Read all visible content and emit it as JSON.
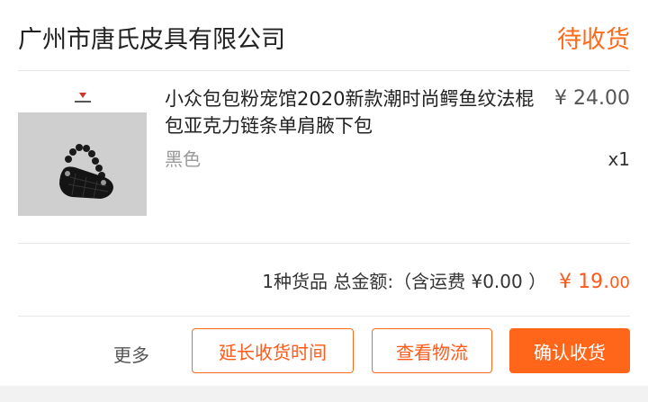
{
  "header": {
    "shop_name": "广州市唐氏皮具有限公司",
    "status": "待收货"
  },
  "item": {
    "title": "小众包包粉宠馆2020新款潮时尚鳄鱼纹法棍包亚克力链条单肩腋下包",
    "variant": "黑色",
    "price": "¥ 24.00",
    "quantity": "x1",
    "image_icon": "black-crocodile-shoulder-bag-image"
  },
  "summary": {
    "text": "1种货品 总金额:（含运费 ¥0.00 ）",
    "currency": "¥",
    "amount_int": "19.",
    "amount_dec": "00"
  },
  "actions": {
    "more": "更多",
    "extend": "延长收货时间",
    "logistics": "查看物流",
    "confirm": "确认收货"
  },
  "colors": {
    "accent": "#ff6a1a",
    "confirm_bg": "#ff6619",
    "muted_text": "#999999"
  }
}
